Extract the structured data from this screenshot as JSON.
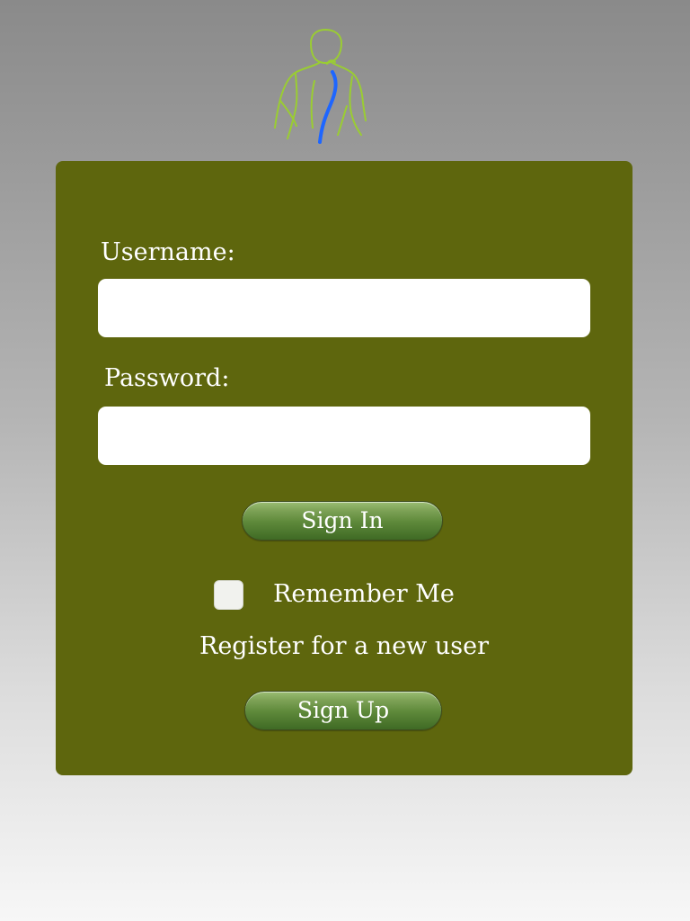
{
  "logo": {
    "icon": "human-spine-icon",
    "outline_color": "#9acd32",
    "spine_color": "#1e66ff"
  },
  "form": {
    "username_label": "Username:",
    "username_value": "",
    "password_label": "Password:",
    "password_value": "",
    "sign_in_label": "Sign In",
    "remember_me_label": "Remember Me",
    "remember_me_checked": false,
    "register_text": "Register for a new user",
    "sign_up_label": "Sign Up"
  },
  "colors": {
    "panel": "#5e660d",
    "button_green": "#5f8a3b",
    "text": "#ffffff"
  }
}
